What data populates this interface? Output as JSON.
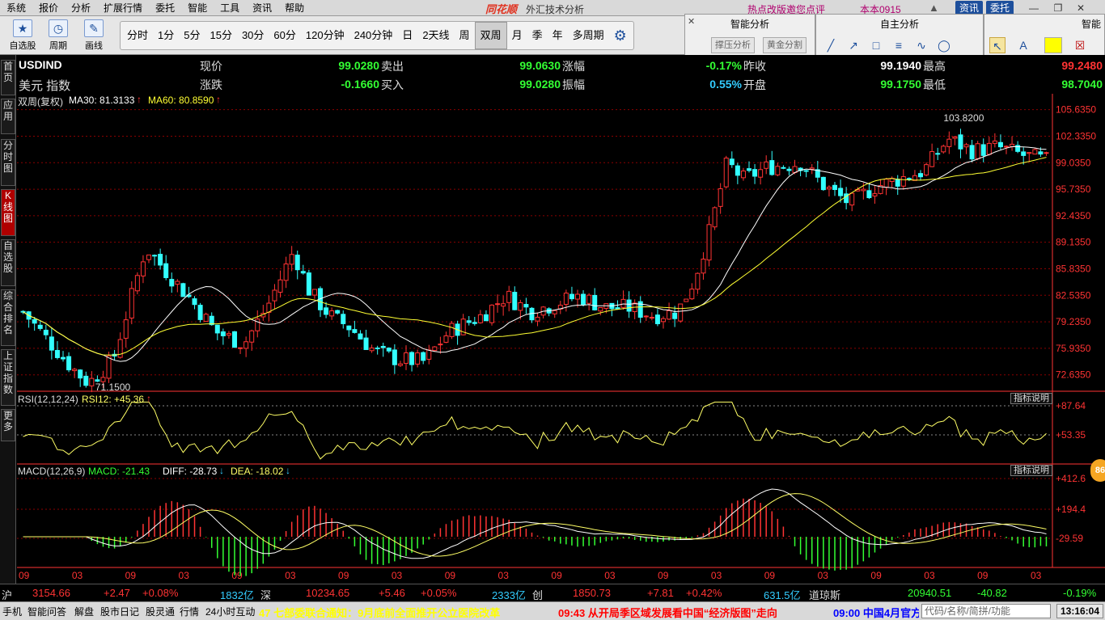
{
  "menubar": {
    "items": [
      "系统",
      "报价",
      "分析",
      "扩展行情",
      "委托",
      "智能",
      "工具",
      "资讯",
      "帮助"
    ],
    "brand": "同花顺",
    "app_title": "外汇技术分析",
    "promo": "热点改版邀您点评",
    "version": "本本0915",
    "news_button": "资讯",
    "trade_button": "委托"
  },
  "toolbar": {
    "left_tools": [
      {
        "label": "自选股",
        "icon": "star-icon"
      },
      {
        "label": "周期",
        "icon": "clock-icon"
      },
      {
        "label": "画线",
        "icon": "pencil-icon"
      }
    ],
    "periods": [
      "分时",
      "1分",
      "5分",
      "15分",
      "30分",
      "60分",
      "120分钟",
      "240分钟",
      "日",
      "2天线",
      "周",
      "双周",
      "月",
      "季",
      "年",
      "多周期"
    ],
    "active_period": "双周"
  },
  "smart_panel": {
    "title": "智能分析",
    "buttons": [
      "撑压分析",
      "黄金分割"
    ]
  },
  "self_panel": {
    "title": "自主分析",
    "tools": [
      "line-icon",
      "ray-icon",
      "rect-icon",
      "channel-icon",
      "wave-icon",
      "ellipse-icon"
    ]
  },
  "right_panel": {
    "title": "智能",
    "tools": [
      "cursor-icon",
      "text-icon",
      "color-swatch-icon",
      "eraser-icon"
    ],
    "swatch_color": "#ffff00"
  },
  "sidebar": {
    "tabs": [
      "首页",
      "应用",
      "分时图",
      "K线图",
      "自选股",
      "综合排名",
      "上证指数",
      "更多"
    ],
    "active": "K线图"
  },
  "quote": {
    "symbol": "USDIND",
    "name": "美元 指数",
    "labels": {
      "current": "现价",
      "change": "涨跌",
      "sell": "卖出",
      "buy": "买入",
      "pct": "涨幅",
      "amplitude": "振幅",
      "prev_close": "昨收",
      "open": "开盘",
      "high": "最高",
      "low": "最低"
    },
    "current": "99.0280",
    "change": "-0.1660",
    "sell": "99.0630",
    "buy": "99.0280",
    "pct": "-0.17%",
    "amplitude": "0.55%",
    "prev_close": "99.1940",
    "open": "99.1750",
    "high": "99.2480",
    "low": "98.7040"
  },
  "kline_info": {
    "period_label": "双周(复权)",
    "ma30": "MA30: 81.3133",
    "ma60": "MA60: 80.8590",
    "high_mark": "103.8200",
    "low_mark": "71.1500"
  },
  "rsi_info": {
    "label": "RSI(12,12,24)",
    "value": "RSI12: +45.36",
    "button": "指标说明"
  },
  "macd_info": {
    "label": "MACD(12,26,9)",
    "macd": "MACD: -21.43",
    "diff": "DIFF: -28.73",
    "dea": "DEA: -18.02",
    "button": "指标说明"
  },
  "badge": "86",
  "colors": {
    "up": "#ff3333",
    "down": "#33ffff",
    "ma30": "#ffffff",
    "ma60": "#ffff33",
    "rsi": "#ffff66",
    "grid": "#8b0000",
    "axis": "#ff3333"
  },
  "chart_data": [
    {
      "type": "candlestick",
      "title": "USDIND",
      "ylim": [
        71.0,
        106.0
      ],
      "y_ticks": [
        "105.6350",
        "102.3350",
        "99.0350",
        "95.7350",
        "92.4350",
        "89.1350",
        "85.8350",
        "82.5350",
        "79.2350",
        "75.9350",
        "72.6350"
      ],
      "x_tick_labels": [
        "09",
        "03",
        "09",
        "03",
        "09",
        "03",
        "09",
        "03",
        "09",
        "03",
        "09",
        "03",
        "09",
        "03",
        "09",
        "03",
        "09",
        "03",
        "09",
        "03"
      ],
      "annotations": [
        {
          "text": "103.8200"
        },
        {
          "text": "71.1500"
        }
      ],
      "series": [
        {
          "name": "MA30",
          "value": 81.3133
        },
        {
          "name": "MA60",
          "value": 80.859
        }
      ]
    },
    {
      "type": "line",
      "title": "RSI(12,12,24)",
      "y_ticks": [
        "+87.64",
        "+53.35"
      ],
      "series": [
        {
          "name": "RSI12",
          "last": 45.36
        }
      ]
    },
    {
      "type": "bar",
      "title": "MACD(12,26,9)",
      "y_ticks": [
        "+412.6",
        "+194.4",
        "-29.59"
      ],
      "series": [
        {
          "name": "MACD",
          "last": -21.43
        },
        {
          "name": "DIFF",
          "last": -28.73
        },
        {
          "name": "DEA",
          "last": -18.02
        }
      ]
    }
  ],
  "statusbar": {
    "sh_label": "沪",
    "sh_index": "3154.66",
    "sh_change": "+2.47",
    "sh_pct": "+0.08%",
    "sh_vol": "1832亿",
    "sz_label": "深",
    "sz_index": "10234.65",
    "sz_change": "+5.46",
    "sz_pct": "+0.05%",
    "sz_vol": "2333亿",
    "cy_label": "创",
    "cy_index": "1850.73",
    "cy_change": "+7.81",
    "cy_pct": "+0.42%",
    "cy_vol": "631.5亿",
    "dj_label": "道琼斯",
    "dj_index": "20940.51",
    "dj_change": "-40.82",
    "dj_pct": "-0.19%"
  },
  "bottombar": {
    "items": [
      "手机",
      "智能问答",
      "解盘",
      "股市日记",
      "股灵通",
      "行情",
      "24小时互动"
    ],
    "news1": "47 七部委联合通知：9月底前全面推开公立医院改革",
    "news2": "09:43 从开局季区域发展看中国“经济版图”走向",
    "news3": "09:00 中国4月官方",
    "search_placeholder": "代码/名称/简拼/功能",
    "clock": "13:16:04"
  }
}
